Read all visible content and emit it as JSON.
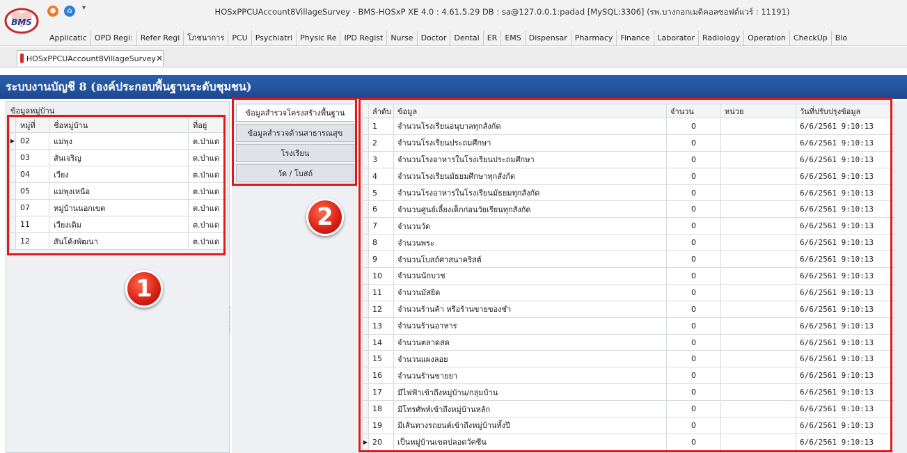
{
  "window": {
    "title": "HOSxPPCUAccount8VillageSurvey - BMS-HOSxP XE 4.0 : 4.61.5.29 DB : sa@127.0.0.1:padad [MySQL:3306] (รพ.บางกอกเมดิคอลซอฟต์แวร์ : 11191)",
    "logo_text": "BMS",
    "quick_access_dropdown": "▾"
  },
  "menu": [
    "Applicatic",
    "OPD Regi:",
    "Refer Regi",
    "โภชนาการ",
    "PCU",
    "Psychiatri",
    "Physic Re",
    "IPD Regist",
    "Nurse",
    "Doctor",
    "Dental",
    "ER",
    "EMS",
    "Dispensar",
    "Pharmacy",
    "Finance",
    "Laborator",
    "Radiology",
    "Operation",
    "CheckUp",
    "Blo"
  ],
  "doc_tab": {
    "label": "HOSxPPCUAccount8VillageSurvey",
    "close": "✕"
  },
  "header": {
    "title": "ระบบงานบัญชี 8 (องค์ประกอบพื้นฐานระดับชุมชน)"
  },
  "village_panel": {
    "caption": "ข้อมูลหมู่บ้าน",
    "columns": [
      "หมู่ที่",
      "ชื่อหมู่บ้าน",
      "ที่อยู่"
    ],
    "rows": [
      {
        "moo": "02",
        "name": "แม่พุง",
        "address": "ต.ป่าแด"
      },
      {
        "moo": "03",
        "name": "สันเจริญ",
        "address": "ต.ป่าแด"
      },
      {
        "moo": "04",
        "name": "เวียง",
        "address": "ต.ป่าแด"
      },
      {
        "moo": "05",
        "name": "แม่พุงเหนือ",
        "address": "ต.ป่าแด"
      },
      {
        "moo": "07",
        "name": "หมู่บ้านนอกเขต",
        "address": "ต.ป่าแด"
      },
      {
        "moo": "11",
        "name": "เวียงเดิม",
        "address": "ต.ป่าแด"
      },
      {
        "moo": "12",
        "name": "สันโค้งพัฒนา",
        "address": "ต.ป่าแด"
      }
    ],
    "current_row_indicator": "▶"
  },
  "survey_tabs": [
    "ข้อมูลสำรวจโครงสร้างพื้นฐาน",
    "ข้อมูลสำรวจด้านสาธารณสุข",
    "โรงเรียน",
    "วัด / โบสถ์"
  ],
  "survey_grid": {
    "columns": [
      "ลำดับ",
      "ข้อมูล",
      "จำนวน",
      "หน่วย",
      "วันที่ปรับปรุงข้อมูล"
    ],
    "rows": [
      {
        "no": "1",
        "item": "จำนวนโรงเรียนอนุบาลทุกสังกัด",
        "count": "0",
        "unit": "",
        "updated": "6/6/2561 9:10:13"
      },
      {
        "no": "2",
        "item": "จำนวนโรงเรียนประถมศึกษา",
        "count": "0",
        "unit": "",
        "updated": "6/6/2561 9:10:13"
      },
      {
        "no": "3",
        "item": "จำนวนโรงอาหารในโรงเรียนประถมศึกษา",
        "count": "0",
        "unit": "",
        "updated": "6/6/2561 9:10:13"
      },
      {
        "no": "4",
        "item": "จำนวนโรงเรียนมัธยมศึกษาทุกสังกัด",
        "count": "0",
        "unit": "",
        "updated": "6/6/2561 9:10:13"
      },
      {
        "no": "5",
        "item": "จำนวนโรงอาหารในโรงเรียนมัธยมทุกสังกัด",
        "count": "0",
        "unit": "",
        "updated": "6/6/2561 9:10:13"
      },
      {
        "no": "6",
        "item": "จำนวนศูนย์เลี้ยงเด็กก่อนวัยเรียนทุกสังกัด",
        "count": "0",
        "unit": "",
        "updated": "6/6/2561 9:10:13"
      },
      {
        "no": "7",
        "item": "จำนวนวัด",
        "count": "0",
        "unit": "",
        "updated": "6/6/2561 9:10:13"
      },
      {
        "no": "8",
        "item": "จำนวนพระ",
        "count": "0",
        "unit": "",
        "updated": "6/6/2561 9:10:13"
      },
      {
        "no": "9",
        "item": "จำนวนโบสถ์ศาสนาคริสต์",
        "count": "0",
        "unit": "",
        "updated": "6/6/2561 9:10:13"
      },
      {
        "no": "10",
        "item": "จำนวนนักบวช",
        "count": "0",
        "unit": "",
        "updated": "6/6/2561 9:10:13"
      },
      {
        "no": "11",
        "item": "จำนวนมัสยิด",
        "count": "0",
        "unit": "",
        "updated": "6/6/2561 9:10:13"
      },
      {
        "no": "12",
        "item": "จำนวนร้านค้า หรือร้านขายของชำ",
        "count": "0",
        "unit": "",
        "updated": "6/6/2561 9:10:13"
      },
      {
        "no": "13",
        "item": "จำนวนร้านอาหาร",
        "count": "0",
        "unit": "",
        "updated": "6/6/2561 9:10:13"
      },
      {
        "no": "14",
        "item": "จำนวนตลาดสด",
        "count": "0",
        "unit": "",
        "updated": "6/6/2561 9:10:13"
      },
      {
        "no": "15",
        "item": "จำนวนแผงลอย",
        "count": "0",
        "unit": "",
        "updated": "6/6/2561 9:10:13"
      },
      {
        "no": "16",
        "item": "จำนวนร้านขายยา",
        "count": "0",
        "unit": "",
        "updated": "6/6/2561 9:10:13"
      },
      {
        "no": "17",
        "item": "มีไฟฟ้าเข้าถึงหมู่บ้าน/กลุ่มบ้าน",
        "count": "0",
        "unit": "",
        "updated": "6/6/2561 9:10:13"
      },
      {
        "no": "18",
        "item": "มีโทรศัพท์เข้าถึงหมู่บ้านหลัก",
        "count": "0",
        "unit": "",
        "updated": "6/6/2561 9:10:13"
      },
      {
        "no": "19",
        "item": "มีเส้นทางรถยนต์เข้าถึงหมู่บ้านทั้งปี",
        "count": "0",
        "unit": "",
        "updated": "6/6/2561 9:10:13"
      },
      {
        "no": "20",
        "item": "เป็นหมู่บ้านเขตปลอดวัคซีน",
        "count": "0",
        "unit": "",
        "updated": "6/6/2561 9:10:13"
      }
    ],
    "current_row_indicator": "▶"
  },
  "callouts": {
    "badge1": "1",
    "badge2": "2",
    "color": "#e01818"
  }
}
